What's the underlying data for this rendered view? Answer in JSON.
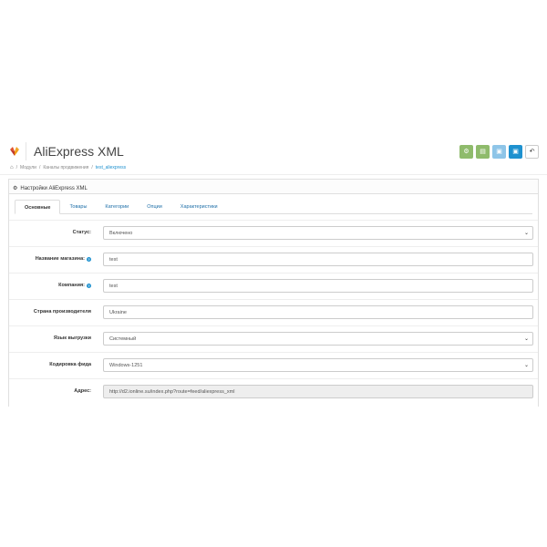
{
  "header": {
    "title": "AliExpress XML",
    "toolbar": [
      {
        "name": "settings-icon",
        "glyph": "⚙",
        "color": "#8fbb6c"
      },
      {
        "name": "list-icon",
        "glyph": "▤",
        "color": "#8fbb6c"
      },
      {
        "name": "save-icon",
        "glyph": "▣",
        "color": "#8ec5e8"
      },
      {
        "name": "floppy-icon",
        "glyph": "▣",
        "color": "#1e91cf"
      },
      {
        "name": "back-icon",
        "glyph": "↶",
        "color": "#ffffff"
      }
    ]
  },
  "breadcrumb": {
    "items": [
      "Модули",
      "Каналы продвижения",
      "test_aliexpress"
    ]
  },
  "panel": {
    "heading": "Настройки AliExpress XML"
  },
  "tabs": [
    "Основные",
    "Товары",
    "Категории",
    "Опции",
    "Характеристики"
  ],
  "form": [
    {
      "label": "Статус:",
      "value": "Включено",
      "type": "select",
      "help": false
    },
    {
      "label": "Название магазина:",
      "value": "test",
      "type": "input",
      "help": true
    },
    {
      "label": "Компания:",
      "value": "test",
      "type": "input",
      "help": true
    },
    {
      "label": "Страна производителя",
      "value": "Ukraine",
      "type": "input",
      "help": false
    },
    {
      "label": "Язык выгрузки",
      "value": "Системный",
      "type": "select",
      "help": false
    },
    {
      "label": "Кодировка фида",
      "value": "Windows-1251",
      "type": "select",
      "help": false
    },
    {
      "label": "Адрес:",
      "value": "http://d2.ionline.su/index.php?route=feed/aliexpress_xml",
      "type": "readonly",
      "help": false
    }
  ]
}
